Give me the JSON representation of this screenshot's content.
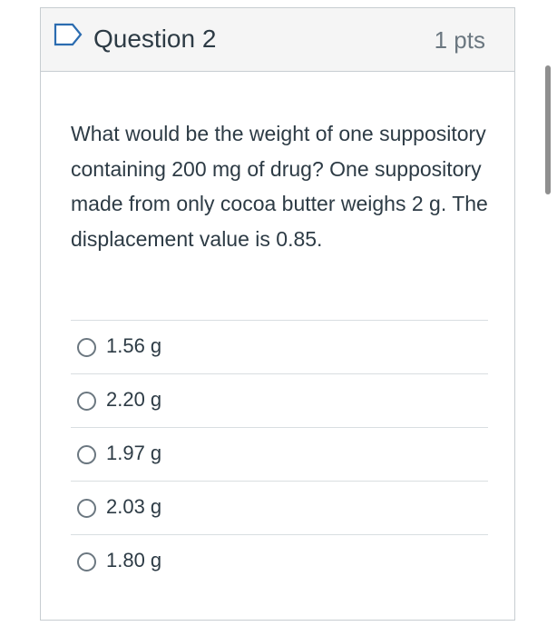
{
  "header": {
    "title": "Question 2",
    "points": "1 pts",
    "flag_icon": "flag-outline-icon",
    "accent_color": "#2b6cb0"
  },
  "question": {
    "text": "What would be the weight of one suppository containing 200 mg of drug? One suppository made from only cocoa butter weighs 2 g. The displacement value is 0.85."
  },
  "answers": [
    {
      "label": "1.56 g"
    },
    {
      "label": "2.20 g"
    },
    {
      "label": "1.97 g"
    },
    {
      "label": "2.03 g"
    },
    {
      "label": "1.80 g"
    }
  ]
}
